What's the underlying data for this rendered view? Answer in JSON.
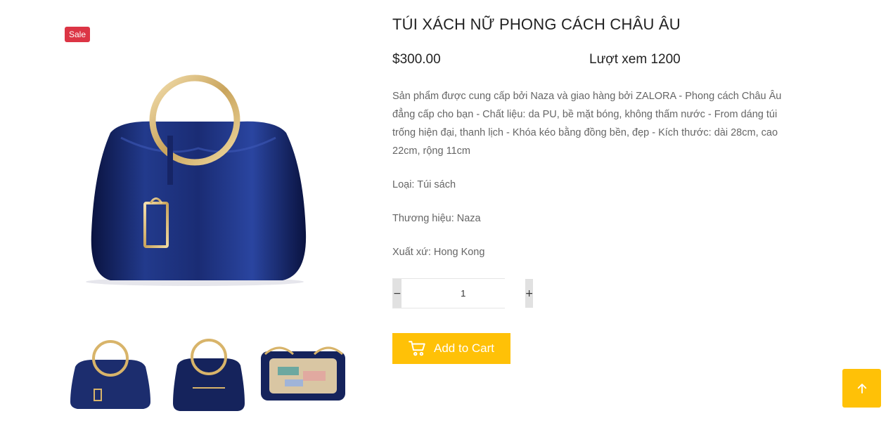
{
  "product": {
    "badge": "Sale",
    "title": "TÚI XÁCH NỮ PHONG CÁCH CHÂU ÂU",
    "price": "$300.00",
    "views": "Lượt xem 1200",
    "description": "Sản phẩm được cung cấp bởi Naza và giao hàng bởi ZALORA - Phong cách Châu Âu đẳng cấp cho bạn - Chất liệu: da PU, bề mặt bóng, không thấm nước - From dáng túi trống hiện đại, thanh lịch - Khóa kéo bằng đồng bền, đẹp - Kích thước: dài 28cm, cao 22cm, rộng 11cm",
    "category": "Loại: Túi sách",
    "brand": "Thương hiệu: Naza",
    "origin": "Xuất xứ: Hong Kong"
  },
  "quantity": {
    "minus_label": "−",
    "value": "1",
    "plus_label": "+"
  },
  "cart": {
    "button_label": "Add to Cart",
    "icon": "cart-icon"
  },
  "back_to_top": {
    "icon": "arrow-up-icon"
  },
  "colors": {
    "accent": "#ffc107",
    "sale": "#dc3545",
    "bag_navy": "#1c2d6e"
  }
}
